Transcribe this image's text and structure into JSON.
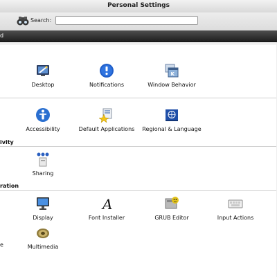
{
  "window": {
    "title": "Personal Settings"
  },
  "toolbar": {
    "search_label": "Search:",
    "search_value": "",
    "search_placeholder": ""
  },
  "tabs": {
    "visible_fragment": "d"
  },
  "sections": [
    {
      "header": "",
      "items": [
        {
          "label": "Desktop",
          "icon": "desktop-effects-icon"
        },
        {
          "label": "Notifications",
          "icon": "info-icon"
        },
        {
          "label": "Window Behavior",
          "icon": "window-behavior-icon"
        }
      ]
    },
    {
      "header": "",
      "items": [
        {
          "label": "Accessibility",
          "icon": "accessibility-icon"
        },
        {
          "label": "Default Applications",
          "icon": "default-applications-icon"
        },
        {
          "label": "Regional & Language",
          "icon": "regional-language-icon"
        }
      ]
    },
    {
      "header": "ivity",
      "items": [
        {
          "label": "Sharing",
          "icon": "sharing-icon"
        }
      ]
    },
    {
      "header": "ration",
      "items": [
        {
          "label": "Display",
          "icon": "display-icon"
        },
        {
          "label": "Font Installer",
          "icon": "font-installer-icon"
        },
        {
          "label": "GRUB Editor",
          "icon": "grub-editor-icon"
        },
        {
          "label": "Input Actions",
          "icon": "input-actions-icon"
        },
        {
          "label": "Multimedia",
          "icon": "multimedia-icon"
        }
      ]
    }
  ],
  "fragments": {
    "partial_left_label": "e"
  },
  "colors": {
    "tab_strip": "#2b2b2b",
    "notification_blue": "#1f5ec9",
    "accessibility_blue": "#2a6fd0",
    "grub_yellow": "#e2c21b"
  }
}
